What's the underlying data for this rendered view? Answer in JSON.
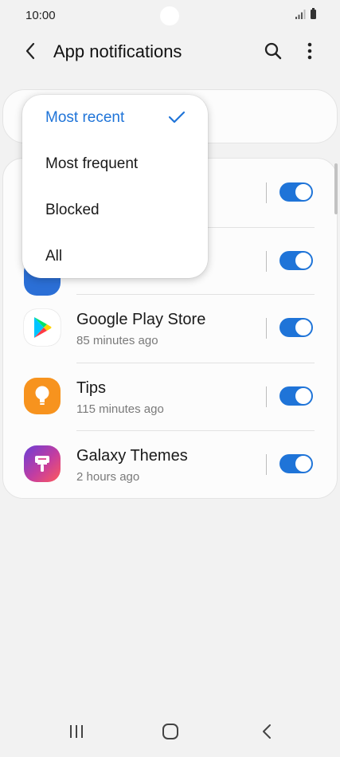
{
  "status_bar": {
    "time": "10:00"
  },
  "app_bar": {
    "title": "App notifications",
    "icons": [
      "back-icon",
      "search-icon",
      "more-vert-icon"
    ]
  },
  "sort_menu": {
    "options": [
      {
        "label": "Most recent",
        "selected": true
      },
      {
        "label": "Most frequent",
        "selected": false
      },
      {
        "label": "Blocked",
        "selected": false
      },
      {
        "label": "All",
        "selected": false
      }
    ],
    "accent_color": "#1f74d8"
  },
  "apps": [
    {
      "name": "Google Play Store",
      "time": "85 minutes ago",
      "enabled": true,
      "icon": "google-play-icon"
    },
    {
      "name": "Tips",
      "time": "115 minutes ago",
      "enabled": true,
      "icon": "tips-bulb-icon"
    },
    {
      "name": "Galaxy Themes",
      "time": "2 hours ago",
      "enabled": true,
      "icon": "galaxy-themes-icon"
    }
  ],
  "hidden_rows": [
    {
      "enabled": true
    },
    {
      "enabled": true
    }
  ],
  "nav_bar": {
    "icons": [
      "recents-icon",
      "home-icon",
      "back-nav-icon"
    ]
  },
  "colors": {
    "toggle_on": "#1f74d8",
    "background": "#f2f2f2",
    "card": "#fcfcfc"
  }
}
